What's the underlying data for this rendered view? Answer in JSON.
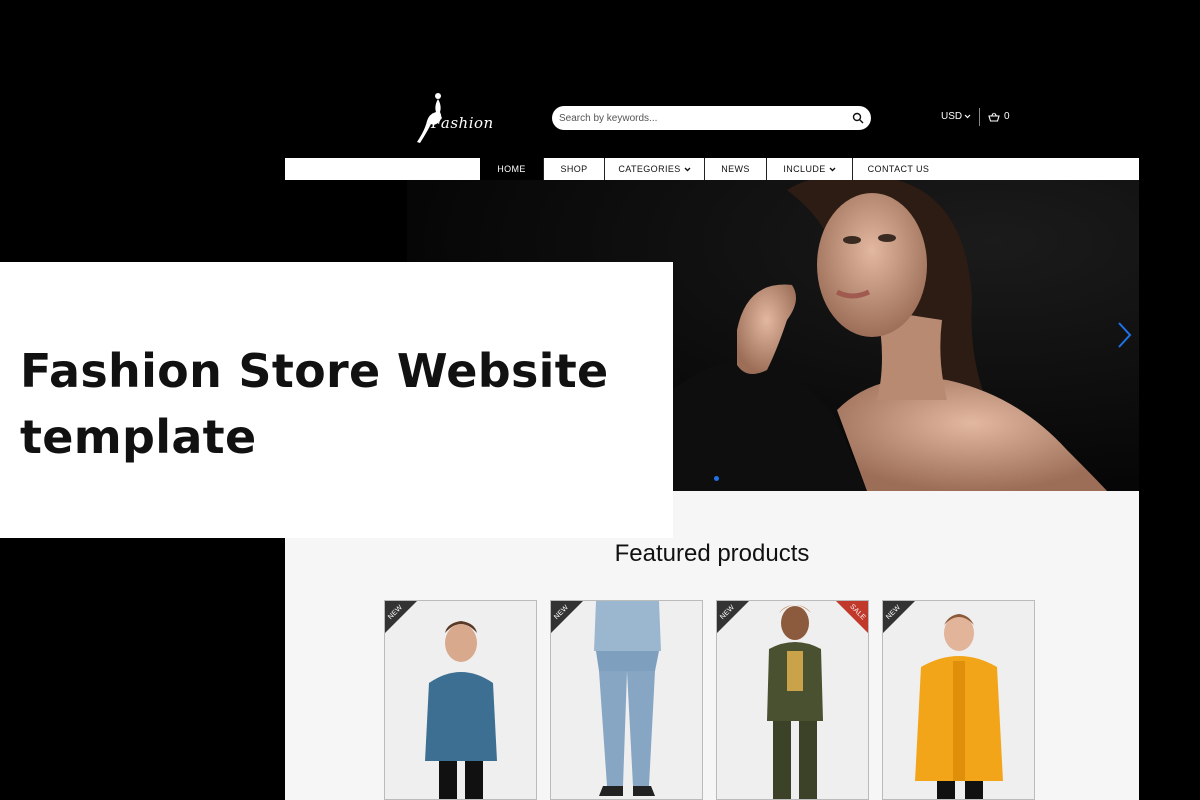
{
  "header": {
    "logo_text": "Fashion",
    "search": {
      "placeholder": "Search by keywords..."
    },
    "currency": "USD",
    "cart_count": "0"
  },
  "nav": {
    "items": [
      {
        "label": "HOME",
        "active": true
      },
      {
        "label": "SHOP"
      },
      {
        "label": "CATEGORIES",
        "dropdown": true
      },
      {
        "label": "NEWS"
      },
      {
        "label": "INCLUDE",
        "dropdown": true
      },
      {
        "label": "CONTACT US"
      }
    ]
  },
  "hero": {
    "slide_count": 1,
    "active_slide": 1
  },
  "featured": {
    "title": "Featured products",
    "products": [
      {
        "badge": "NEW",
        "jacket_color": "#3d6f93"
      },
      {
        "badge": "NEW",
        "jacket_color": "#9bb7cf"
      },
      {
        "badge": "NEW",
        "second_badge": "SALE",
        "jacket_color": "#4a5130"
      },
      {
        "badge": "NEW",
        "jacket_color": "#f3a51a"
      }
    ]
  },
  "overlay": {
    "line1": "Fashion Store Website",
    "line2": "template"
  },
  "colors": {
    "accent": "#1e73e8",
    "sale_badge": "#c0392b",
    "new_badge": "#333333"
  }
}
